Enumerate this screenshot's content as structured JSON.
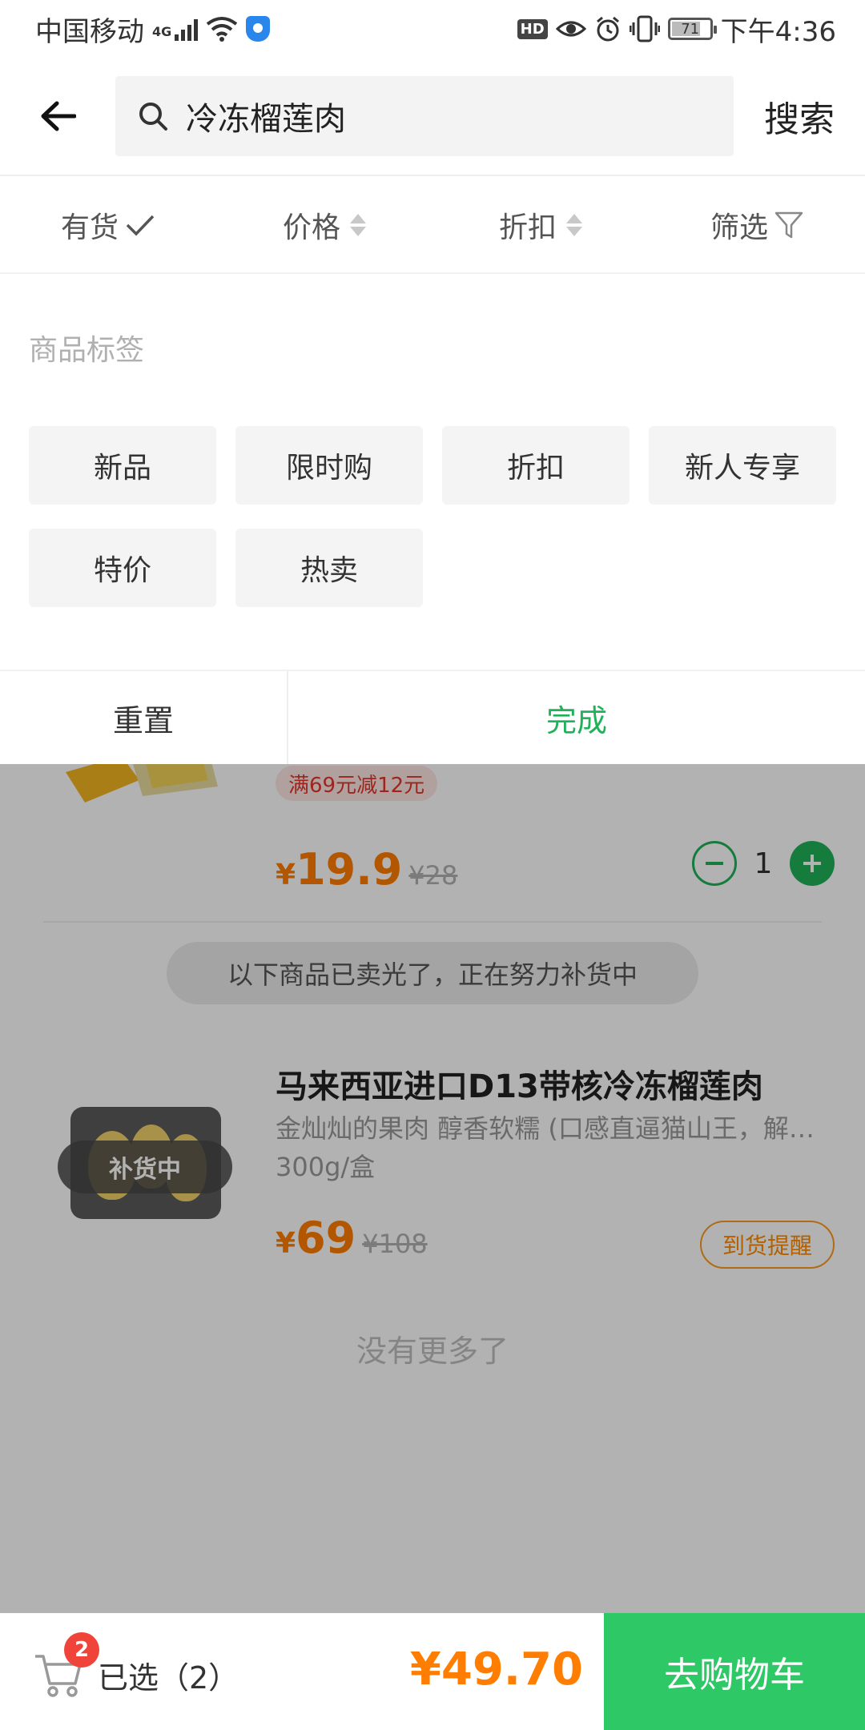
{
  "status_bar": {
    "carrier": "中国移动",
    "network": "4G",
    "battery": "71",
    "time": "下午4:36",
    "hd": "HD"
  },
  "search": {
    "query": "冷冻榴莲肉",
    "submit_label": "搜索"
  },
  "sort_bar": {
    "in_stock": "有货",
    "price": "价格",
    "discount": "折扣",
    "filter": "筛选"
  },
  "filter_panel": {
    "title": "商品标签",
    "tags": [
      "新品",
      "限时购",
      "折扣",
      "新人专享",
      "特价",
      "热卖"
    ],
    "reset_label": "重置",
    "done_label": "完成"
  },
  "products": {
    "item1": {
      "promo": "满69元减12元",
      "currency": "¥",
      "price": "19.9",
      "original_price": "¥28",
      "quantity": "1"
    },
    "soldout_notice": "以下商品已卖光了，正在努力补货中",
    "item2": {
      "title": "马来西亚进口D13带核冷冻榴莲肉",
      "description": "金灿灿的果肉 醇香软糯 (口感直逼猫山王，解冻即食)",
      "spec": "300g/盒",
      "badge": "补货中",
      "currency": "¥",
      "price": "69",
      "original_price": "¥108",
      "remind_label": "到货提醒"
    },
    "no_more": "没有更多了"
  },
  "cart": {
    "count": "2",
    "selected_label": "已选（2）",
    "total": "¥49.70",
    "checkout_label": "去购物车"
  },
  "colors": {
    "brand_green": "#1fb25a",
    "checkout_green": "#2ec867",
    "price_orange": "#ff7d00",
    "badge_red": "#f0443a"
  }
}
